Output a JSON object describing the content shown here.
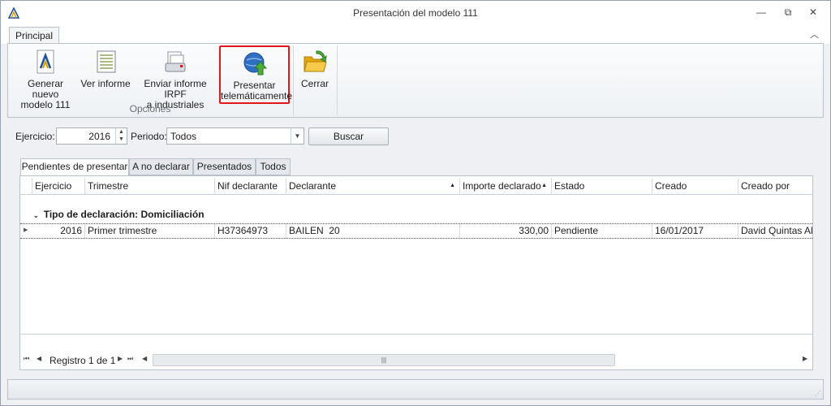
{
  "window": {
    "title": "Presentación del modelo 111",
    "minimize": "▭",
    "restore": "⧉",
    "close": "✕"
  },
  "ribbon": {
    "tab": "Principal",
    "collapse": "︿",
    "buttons": {
      "generar_line1": "Generar nuevo",
      "generar_line2": "modelo 111",
      "ver_informe": "Ver informe",
      "enviar_line1": "Enviar informe IRPF",
      "enviar_line2": "a industriales",
      "presentar_line1": "Presentar",
      "presentar_line2": "telemáticamente",
      "cerrar": "Cerrar"
    },
    "group_caption": "Opciones",
    "icons": [
      "aeat-logo-icon",
      "report-sheet-icon",
      "printer-document-icon",
      "globe-upload-icon",
      "open-folder-icon"
    ]
  },
  "filters": {
    "ejercicio_label": "Ejercicio:",
    "ejercicio_value": "2016",
    "periodo_label": "Periodo:",
    "periodo_value": "Todos",
    "buscar": "Buscar"
  },
  "tabs": [
    "Pendientes de presentar",
    "A no declarar",
    "Presentados",
    "Todos"
  ],
  "grid": {
    "columns": [
      "Ejercicio",
      "Trimestre",
      "Nif declarante",
      "Declarante",
      "Importe declarado",
      "Estado",
      "Creado",
      "Creado por"
    ],
    "group_label": "Tipo de declaración: Domiciliación",
    "rows": [
      {
        "ejercicio": "2016",
        "trimestre": "Primer trimestre",
        "nif": "H37364973",
        "declarante": "BAILEN  20",
        "importe": "330,00",
        "estado": "Pendiente",
        "creado": "16/01/2017",
        "creado_por": "David Quintas Alcalde"
      }
    ],
    "navigator": "Registro 1 de 1"
  },
  "colors": {
    "highlight_border": "#e0161b",
    "window_bg": "#eef0f3"
  }
}
